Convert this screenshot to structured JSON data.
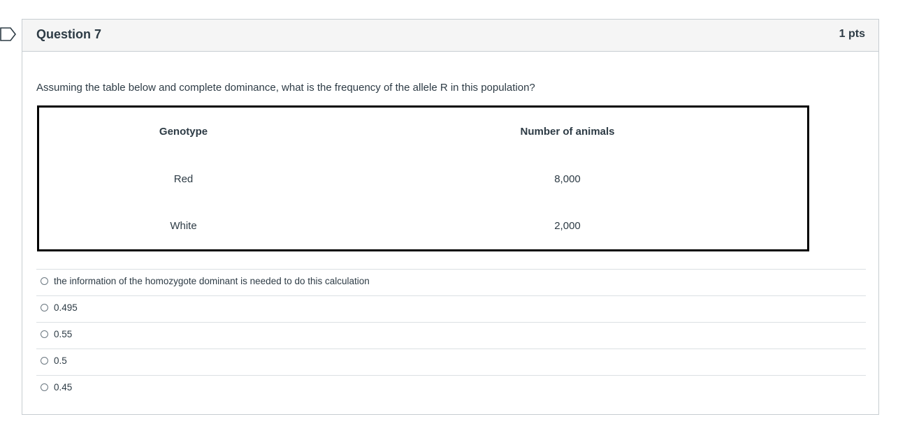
{
  "question": {
    "title": "Question 7",
    "points": "1 pts",
    "text": "Assuming the table below and complete dominance, what is the frequency of the allele R in this population?",
    "table": {
      "headers": [
        "Genotype",
        "Number of animals"
      ],
      "rows": [
        [
          "Red",
          "8,000"
        ],
        [
          "White",
          "2,000"
        ]
      ]
    },
    "answers": [
      "the information of the homozygote dominant is needed to do this calculation",
      "0.495",
      "0.55",
      "0.5",
      "0.45"
    ]
  },
  "icons": {
    "flag": "flag-outline-icon"
  },
  "colors": {
    "header_bg": "#f5f5f5",
    "border": "#c7cdd1",
    "text": "#2d3b45"
  }
}
